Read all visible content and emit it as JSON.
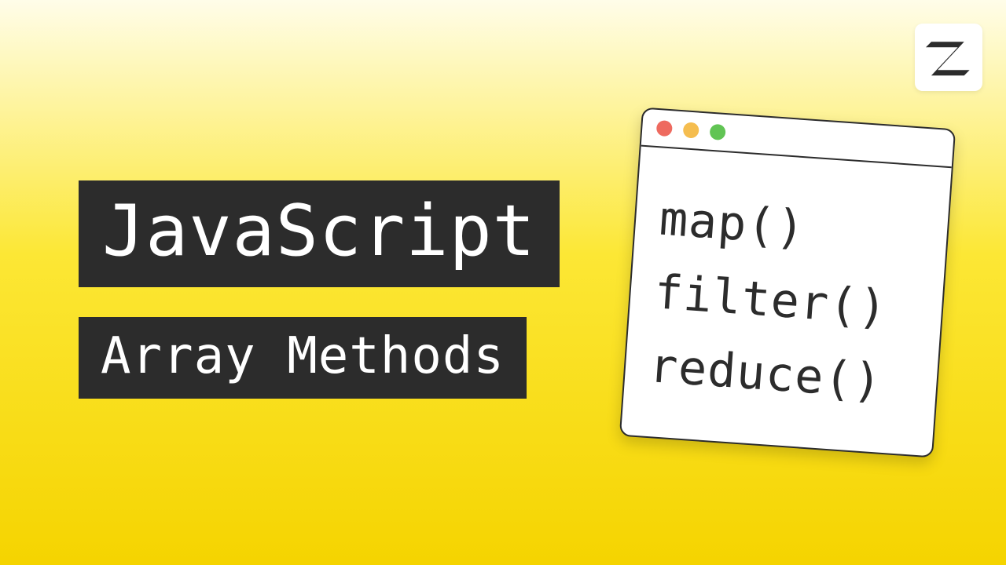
{
  "title": {
    "primary": "JavaScript",
    "secondary": "Array Methods"
  },
  "window": {
    "lines": [
      "map()",
      "filter()",
      "reduce()"
    ],
    "traffic_lights": [
      "red",
      "yellow",
      "green"
    ]
  },
  "logo": {
    "letter": "Z"
  },
  "colors": {
    "bg_top": "#fffde9",
    "bg_mid": "#fce735",
    "bg_bottom": "#f5d400",
    "chip_bg": "#2c2c2c",
    "chip_fg": "#ffffff",
    "win_bg": "#ffffff",
    "win_border": "#2c2c2c",
    "dot_red": "#ee6a5f",
    "dot_yellow": "#f5bd4f",
    "dot_green": "#61c454"
  }
}
